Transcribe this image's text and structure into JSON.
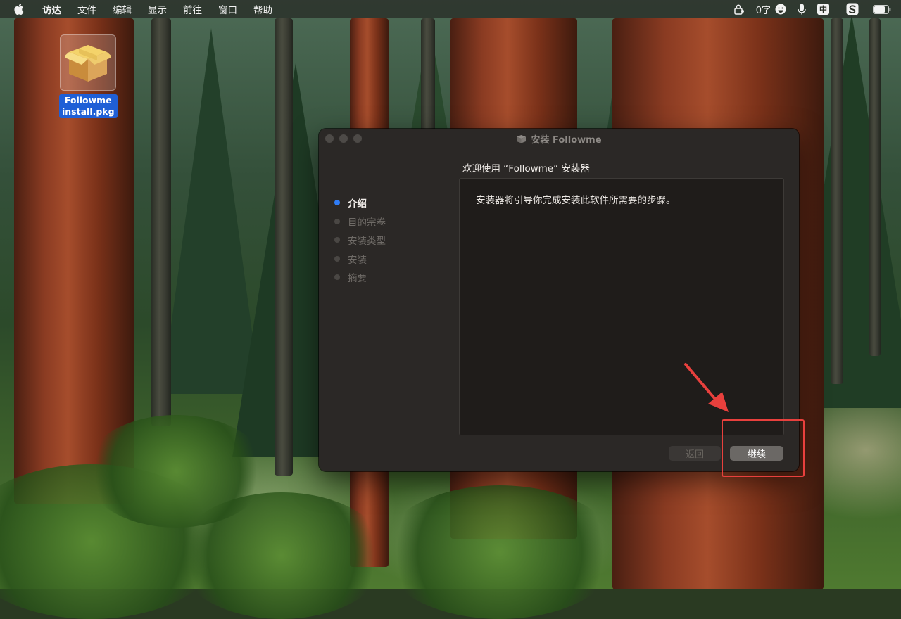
{
  "menubar": {
    "app_name": "访达",
    "items": [
      "文件",
      "编辑",
      "显示",
      "前往",
      "窗口",
      "帮助"
    ],
    "word_count": "0字",
    "input_badge": "中",
    "status_icons": [
      "apple-icon",
      "lock-person-icon",
      "emoji-icon",
      "microphone-icon",
      "input-method-icon",
      "sogou-icon",
      "battery-icon"
    ]
  },
  "desktop": {
    "icon_label_line1": "Followme",
    "icon_label_line2": "install.pkg",
    "icon": "package-icon",
    "label_color": "#1f5fd6"
  },
  "installer": {
    "window_title": "安装 Followme",
    "heading": "欢迎使用 “Followme” 安装器",
    "steps": [
      {
        "label": "介绍",
        "active": true
      },
      {
        "label": "目的宗卷",
        "active": false
      },
      {
        "label": "安装类型",
        "active": false
      },
      {
        "label": "安装",
        "active": false
      },
      {
        "label": "摘要",
        "active": false
      }
    ],
    "body_text": "安装器将引导你完成安装此软件所需要的步骤。",
    "back_label": "返回",
    "continue_label": "继续",
    "active_step_color": "#2f7cf6"
  },
  "annotation": {
    "highlight_color": "#e8403d",
    "target": "continue-button"
  }
}
